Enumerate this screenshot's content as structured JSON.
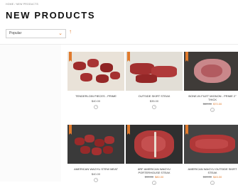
{
  "breadcrumb": "HOME / NEW PRODUCTS",
  "page_title": "NEW PRODUCTS",
  "sort": {
    "selected": "Popular"
  },
  "products": [
    {
      "name": "TENDERLOIN PIECES - PRIME",
      "price": "$40.00",
      "old_price": "",
      "sale_price": ""
    },
    {
      "name": "OUTSIDE SKIRT STEAK",
      "price": "$35.00",
      "old_price": "",
      "sale_price": ""
    },
    {
      "name": "BONE-IN FILET MIGNON - PRIME 2\" THICK",
      "price": "",
      "old_price": "$80.00",
      "sale_price": "$70.00"
    },
    {
      "name": "AMERICAN WAGYU STEW MEAT",
      "price": "$40.00",
      "old_price": "",
      "sale_price": ""
    },
    {
      "name": "8RF AMERICAN WAGYU PORTERHOUSE STEAK",
      "price": "",
      "old_price": "$99.00",
      "sale_price": "$80.00"
    },
    {
      "name": "AMERICAN WAGYU OUTSIDE SKIRT STEAK",
      "price": "",
      "old_price": "$49.00",
      "sale_price": "$45.00"
    }
  ],
  "colors": {
    "accent": "#e07a2c"
  },
  "icons": {
    "sort_direction": "arrow-up-icon",
    "wishlist": "heart-icon"
  }
}
